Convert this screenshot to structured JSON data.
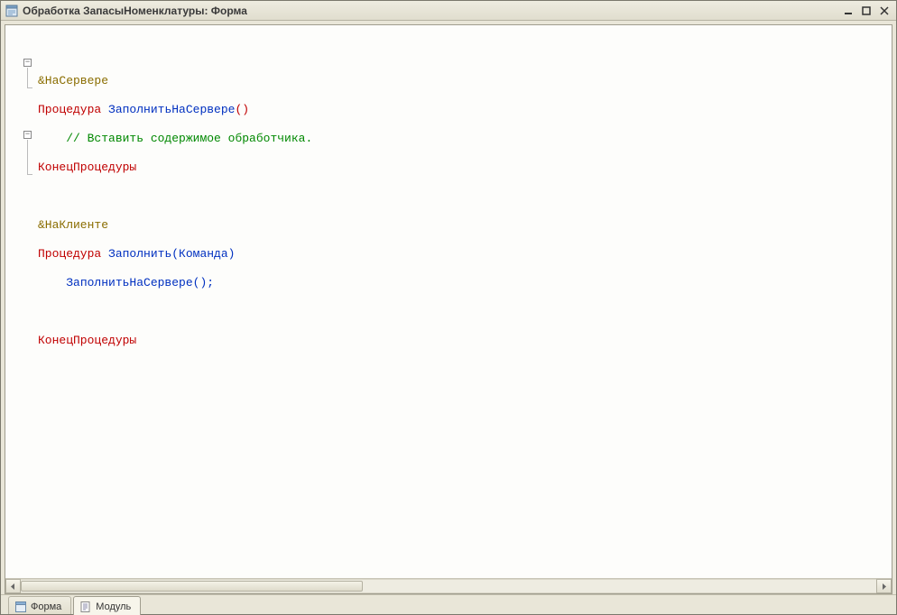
{
  "window": {
    "title": "Обработка ЗапасыНоменклатуры: Форма"
  },
  "code": {
    "blocks": [
      {
        "directive": "&НаСервере",
        "proc_keyword": "Процедура",
        "proc_name": "ЗаполнитьНаСервере",
        "proc_params": "()",
        "body": [
          {
            "type": "comment",
            "text": "// Вставить содержимое обработчика."
          }
        ],
        "end_keyword": "КонецПроцедуры"
      },
      {
        "directive": "&НаКлиенте",
        "proc_keyword": "Процедура",
        "proc_name": "Заполнить",
        "proc_params": "(Команда)",
        "body": [
          {
            "type": "call",
            "text": "ЗаполнитьНаСервере();"
          },
          {
            "type": "blank",
            "text": ""
          }
        ],
        "end_keyword": "КонецПроцедуры"
      }
    ]
  },
  "tabs": [
    {
      "id": "form",
      "label": "Форма",
      "active": false
    },
    {
      "id": "module",
      "label": "Модуль",
      "active": true
    }
  ]
}
